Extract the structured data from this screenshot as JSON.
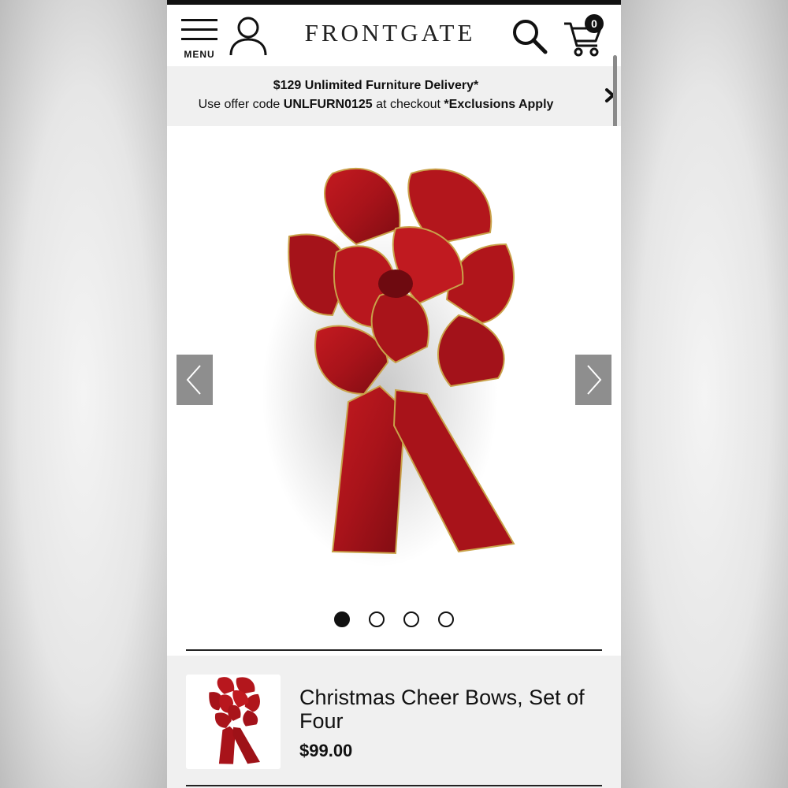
{
  "header": {
    "menu_label": "MENU",
    "logo": "FRONTGATE",
    "cart_count": "0"
  },
  "promo": {
    "line1": "$129 Unlimited Furniture Delivery*",
    "line2_prefix": "Use offer code ",
    "offer_code": "UNLFURN0125",
    "line2_middle": " at checkout ",
    "exclusions": "*Exclusions Apply"
  },
  "gallery": {
    "image_count": 4,
    "active_index": 0
  },
  "product": {
    "title": "Christmas Cheer Bows, Set of Four",
    "price": "$99.00"
  },
  "colors": {
    "bow_red": "#b0141a",
    "bow_gold_edge": "#c9a24a",
    "arrow_button": "#8e8e8e"
  },
  "icons": {
    "menu": "hamburger-icon",
    "account": "user-icon",
    "search": "search-icon",
    "cart": "cart-icon",
    "promo_next": "chevron-right-icon",
    "prev": "chevron-left-icon",
    "next": "chevron-right-icon"
  }
}
